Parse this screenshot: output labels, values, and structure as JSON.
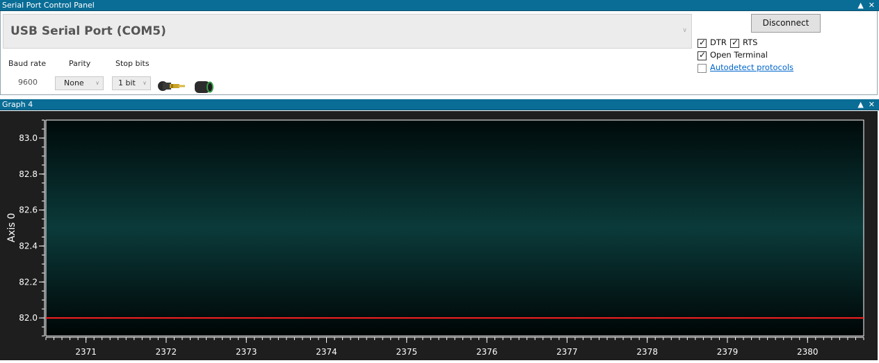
{
  "window1": {
    "title": "Serial Port Control Panel"
  },
  "port": {
    "selected": "USB Serial Port (COM5)"
  },
  "settings": {
    "baud_label": "Baud rate",
    "baud_value": "9600",
    "parity_label": "Parity",
    "parity_value": "None",
    "stop_label": "Stop bits",
    "stop_value": "1 bit"
  },
  "controls": {
    "disconnect_label": "Disconnect",
    "dtr_label": "DTR",
    "dtr_checked": true,
    "rts_label": "RTS",
    "rts_checked": true,
    "open_terminal_label": "Open Terminal",
    "open_terminal_checked": true,
    "autodetect_label": "Autodetect protocols",
    "autodetect_checked": false
  },
  "window2": {
    "title": "Graph 4"
  },
  "colors": {
    "titlebar": "#0a6d96",
    "series": "#ff2020",
    "plot_bg_top": "#000a0a",
    "plot_bg_mid": "#0b3a3a"
  },
  "chart_data": {
    "type": "line",
    "title": "",
    "xlabel": "",
    "ylabel": "Axis 0",
    "xlim": [
      2370.5,
      2380.7
    ],
    "ylim": [
      81.9,
      83.1
    ],
    "x_ticks": [
      2371,
      2372,
      2373,
      2374,
      2375,
      2376,
      2377,
      2378,
      2379,
      2380
    ],
    "y_ticks": [
      "82.0",
      "82.2",
      "82.4",
      "82.6",
      "82.8",
      "83.0"
    ],
    "series": [
      {
        "x": [
          2370.5,
          2380.7
        ],
        "y": [
          82.0,
          82.0
        ],
        "color": "#ff2020"
      }
    ],
    "grid": false
  }
}
